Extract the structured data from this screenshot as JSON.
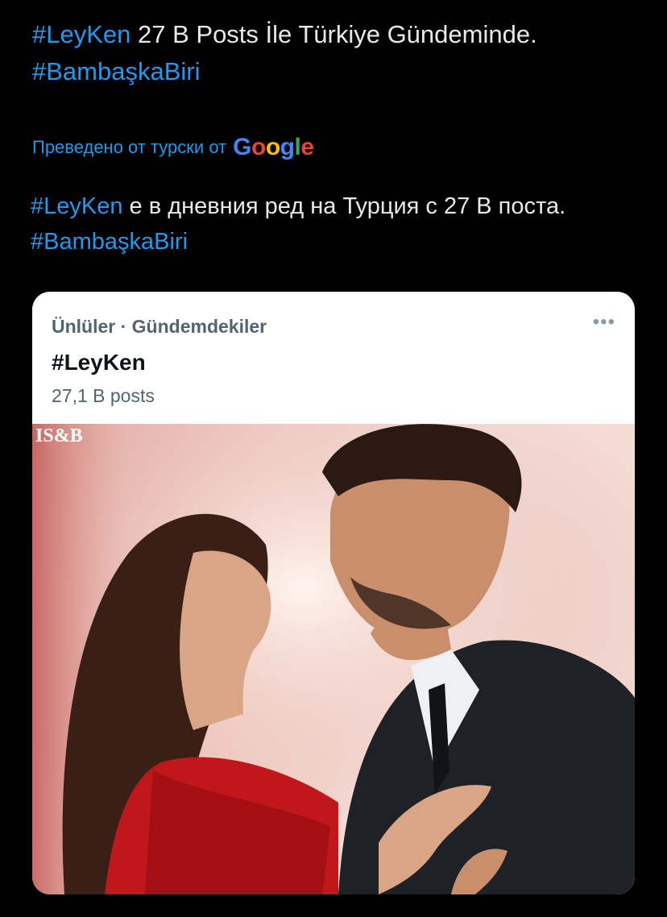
{
  "tweet": {
    "hashtag1": "#LeyKen",
    "text1": " 27 B Posts İle Türkiye Gündeminde.",
    "hashtag2": "#BambaşkaBiri"
  },
  "translation": {
    "label": "Преведено от турски от",
    "provider": "Google",
    "hashtag1": "#LeyKen",
    "text1": " е в дневния ред на Турция с 27 B поста.",
    "hashtag2": "#BambaşkaBiri"
  },
  "card": {
    "category": "Ünlüler · Gündemdekiler",
    "title": "#LeyKen",
    "count": "27,1 B posts",
    "more_icon": "more-dots-icon",
    "image_mark": "IS&B"
  },
  "colors": {
    "background": "#000000",
    "text": "#e7e9ea",
    "link": "#1d9bf0",
    "card_bg": "#ffffff"
  }
}
